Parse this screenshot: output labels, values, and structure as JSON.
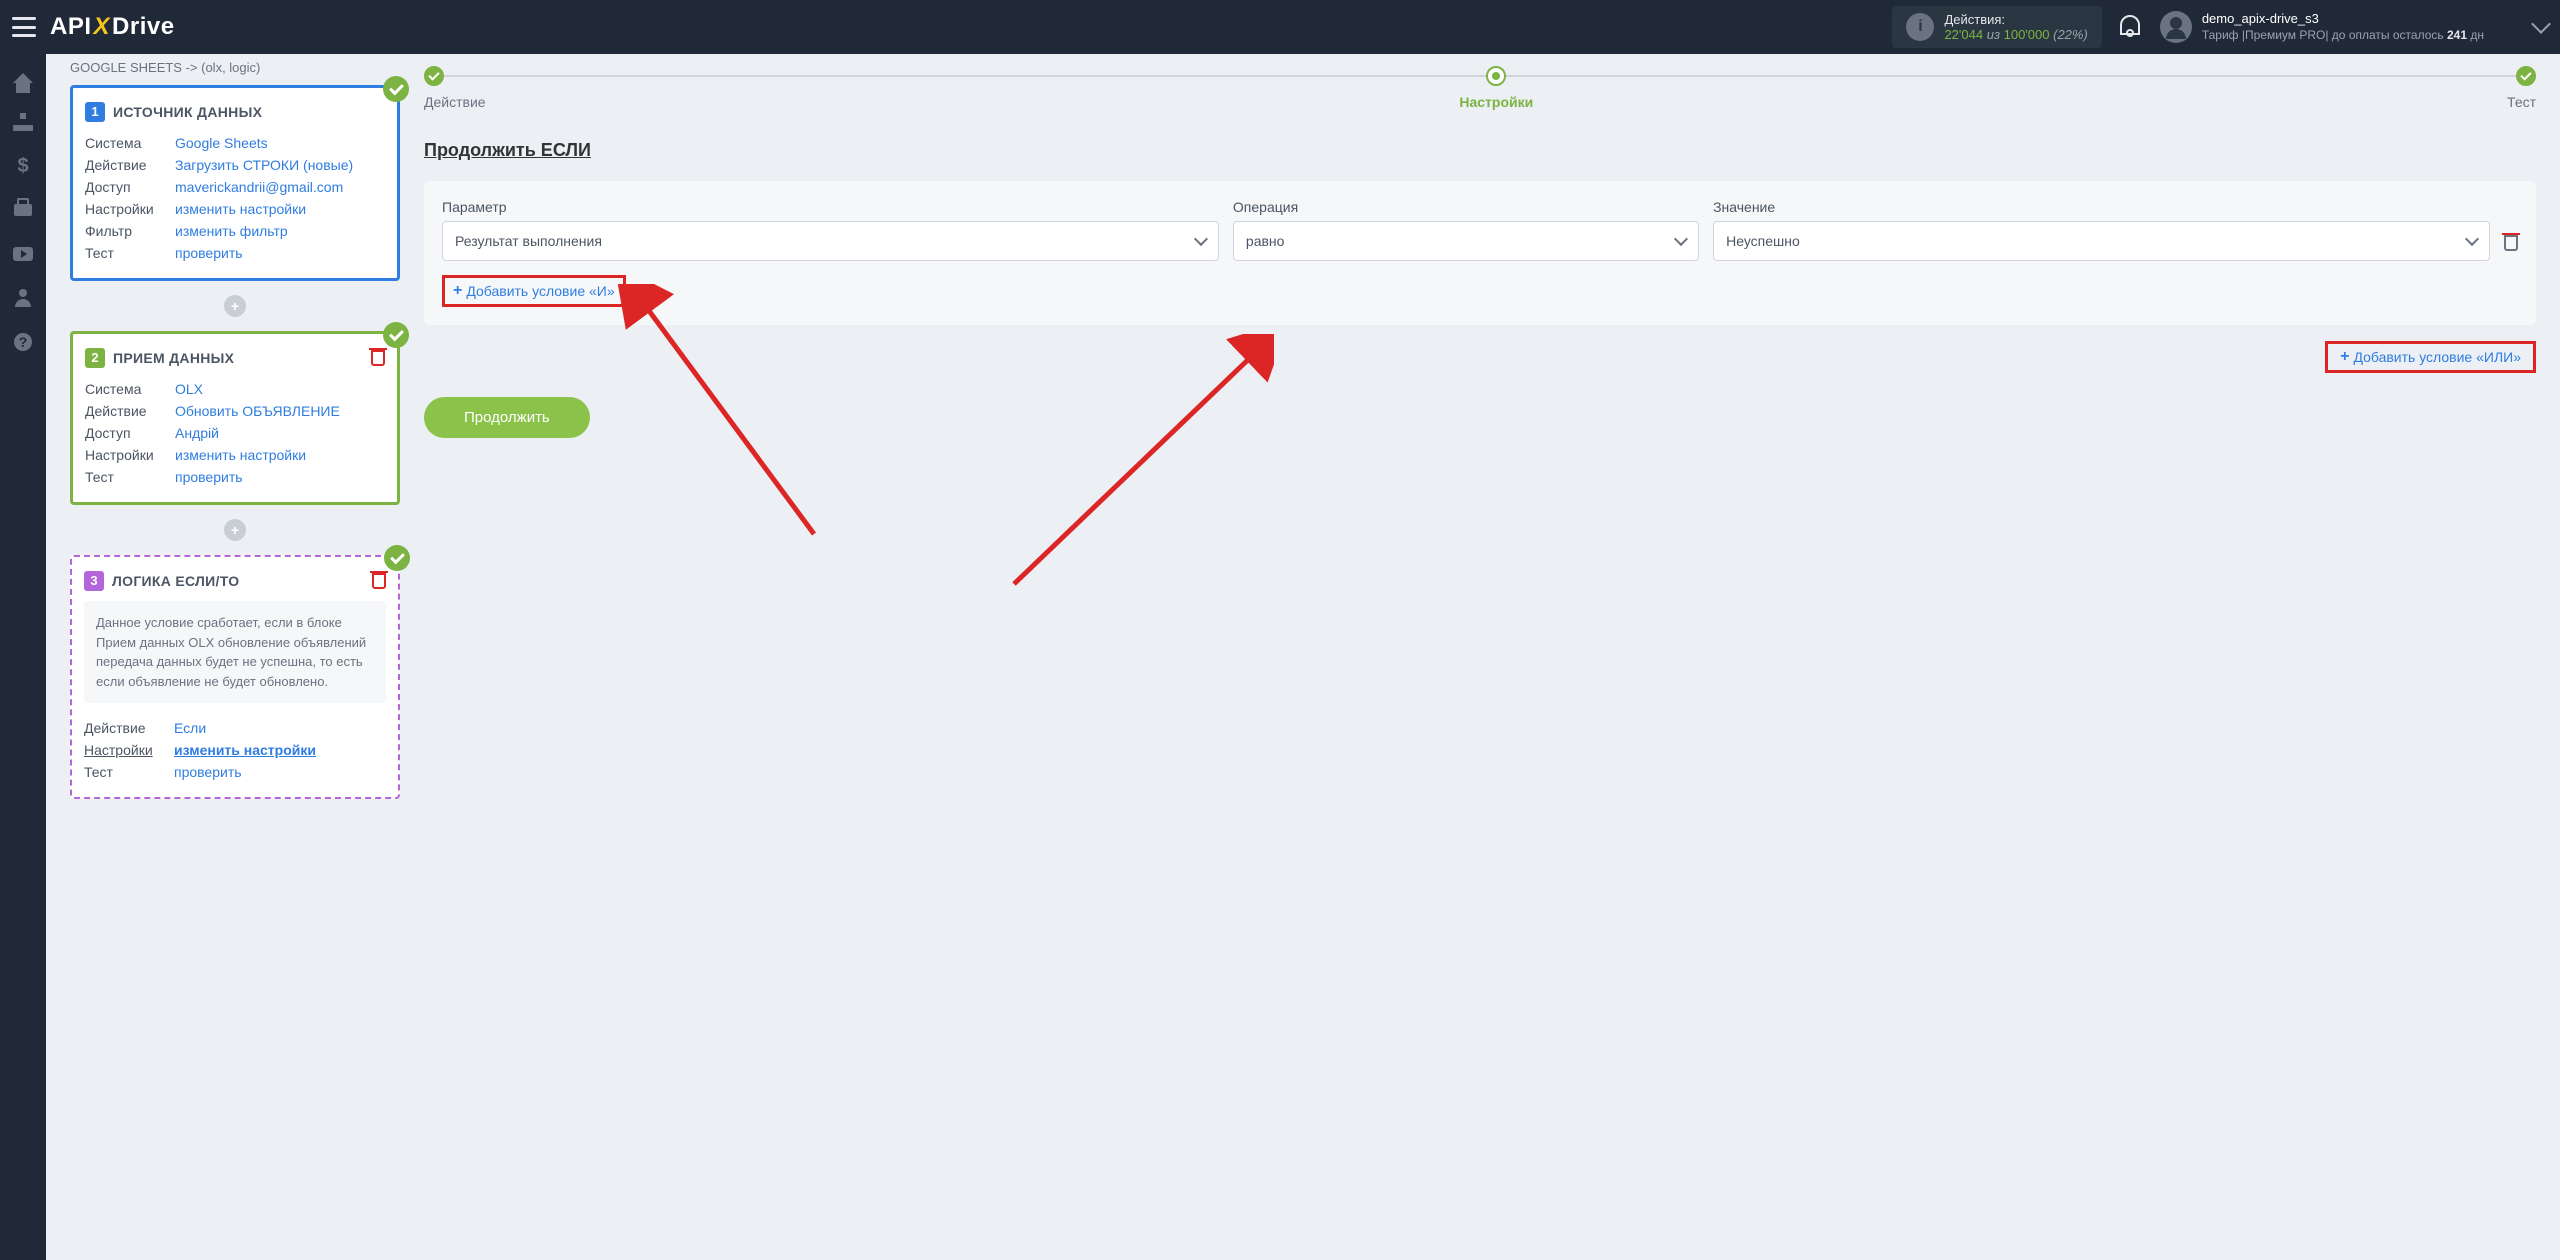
{
  "topbar": {
    "actions_label": "Действия:",
    "actions_used": "22'044",
    "actions_sep": "из",
    "actions_total": "100'000",
    "actions_pct": "(22%)",
    "user_name": "demo_apix-drive_s3",
    "plan_prefix": "Тариф |Премиум PRO|  до оплаты осталось",
    "plan_days": "241",
    "plan_unit": "дн"
  },
  "breadcrumb": "GOOGLE SHEETS -> (olx, logic)",
  "block1": {
    "title": "ИСТОЧНИК ДАННЫХ",
    "rows": {
      "system_l": "Система",
      "system_v": "Google Sheets",
      "action_l": "Действие",
      "action_v": "Загрузить СТРОКИ (новые)",
      "access_l": "Доступ",
      "access_v": "maverickandrii@gmail.com",
      "settings_l": "Настройки",
      "settings_v": "изменить настройки",
      "filter_l": "Фильтр",
      "filter_v": "изменить фильтр",
      "test_l": "Тест",
      "test_v": "проверить"
    }
  },
  "block2": {
    "title": "ПРИЕМ ДАННЫХ",
    "rows": {
      "system_l": "Система",
      "system_v": "OLX",
      "action_l": "Действие",
      "action_v": "Обновить ОБЪЯВЛЕНИЕ",
      "access_l": "Доступ",
      "access_v": "Андрій",
      "settings_l": "Настройки",
      "settings_v": "изменить настройки",
      "test_l": "Тест",
      "test_v": "проверить"
    }
  },
  "block3": {
    "title": "ЛОГИКА ЕСЛИ/ТО",
    "desc": "Данное условие сработает, если в блоке Прием данных OLX обновление объявлений передача данных будет не успешна, то есть если объявление не будет обновлено.",
    "rows": {
      "action_l": "Действие",
      "action_v": "Если",
      "settings_l": "Настройки",
      "settings_v": "изменить настройки",
      "test_l": "Тест",
      "test_v": "проверить"
    }
  },
  "stepper": {
    "step1": "Действие",
    "step2": "Настройки",
    "step3": "Тест"
  },
  "main": {
    "heading": "Продолжить ЕСЛИ",
    "param_label": "Параметр",
    "param_value": "Результат выполнения",
    "op_label": "Операция",
    "op_value": "равно",
    "val_label": "Значение",
    "val_value": "Неуспешно",
    "add_and": "Добавить условие «И»",
    "add_or": "Добавить условие «ИЛИ»",
    "continue": "Продолжить"
  }
}
